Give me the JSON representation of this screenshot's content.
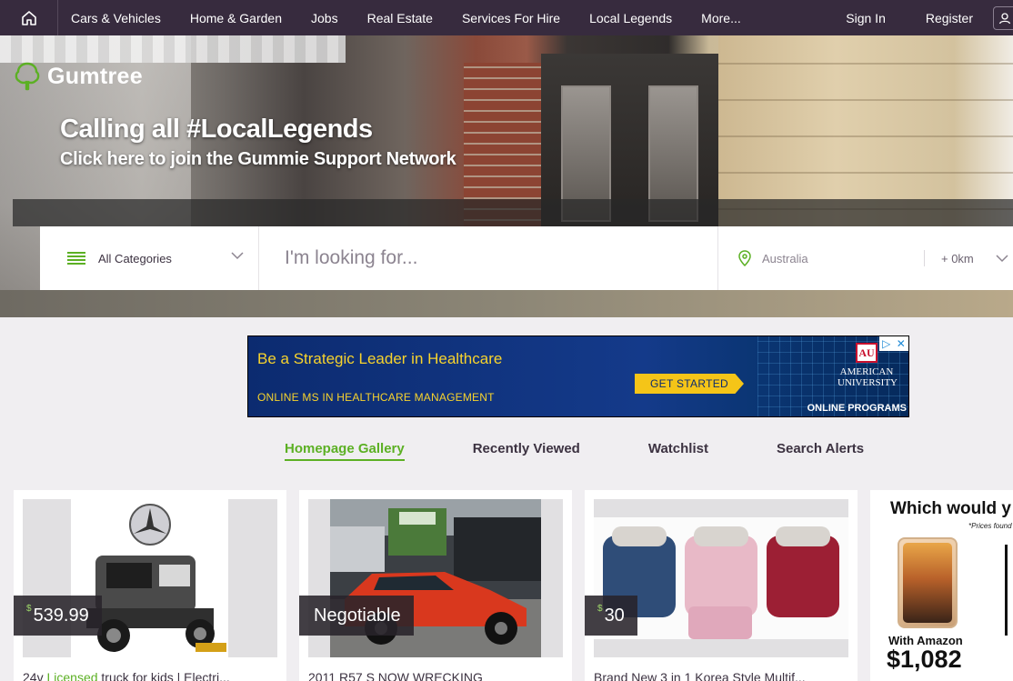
{
  "nav": {
    "items": [
      "Cars & Vehicles",
      "Home & Garden",
      "Jobs",
      "Real Estate",
      "Services For Hire",
      "Local Legends",
      "More..."
    ],
    "sign_in": "Sign In",
    "register": "Register"
  },
  "hero": {
    "logo_text": "Gumtree",
    "title": "Calling all #LocalLegends",
    "subtitle": "Click here to join the Gummie Support Network"
  },
  "search": {
    "category_label": "All Categories",
    "placeholder": "I'm looking for...",
    "location": "Australia",
    "radius": "+ 0km"
  },
  "ad": {
    "headline": "Be a Strategic Leader in Healthcare",
    "subline": "ONLINE MS IN HEALTHCARE MANAGEMENT",
    "cta": "GET STARTED",
    "logo_mark": "AU",
    "university": "AMERICAN UNIVERSITY",
    "online": "ONLINE PROGRAMS"
  },
  "tabs": [
    {
      "label": "Homepage Gallery",
      "active": true
    },
    {
      "label": "Recently Viewed",
      "active": false
    },
    {
      "label": "Watchlist",
      "active": false
    },
    {
      "label": "Search Alerts",
      "active": false
    }
  ],
  "listings": [
    {
      "currency": "$",
      "price": "539.99",
      "title_prefix": "24v ",
      "title_highlight": "Licensed",
      "title_rest": " truck for kids | Electri..."
    },
    {
      "currency": "",
      "price": "Negotiable",
      "title_prefix": "2011 R57 S NOW WRECKING",
      "title_highlight": "",
      "title_rest": ""
    },
    {
      "currency": "$",
      "price": "30",
      "title_prefix": "Brand New 3 in 1 Korea Style Multif...",
      "title_highlight": "",
      "title_rest": ""
    }
  ],
  "side_ad": {
    "headline": "Which would y",
    "note": "*Prices found",
    "with": "With Amazon",
    "amount": "$1,082"
  },
  "colors": {
    "nav_bg": "#372b3e",
    "brand_green": "#5cb024",
    "ad_yellow": "#f7d32d",
    "ad_blue": "#0c2b70"
  }
}
